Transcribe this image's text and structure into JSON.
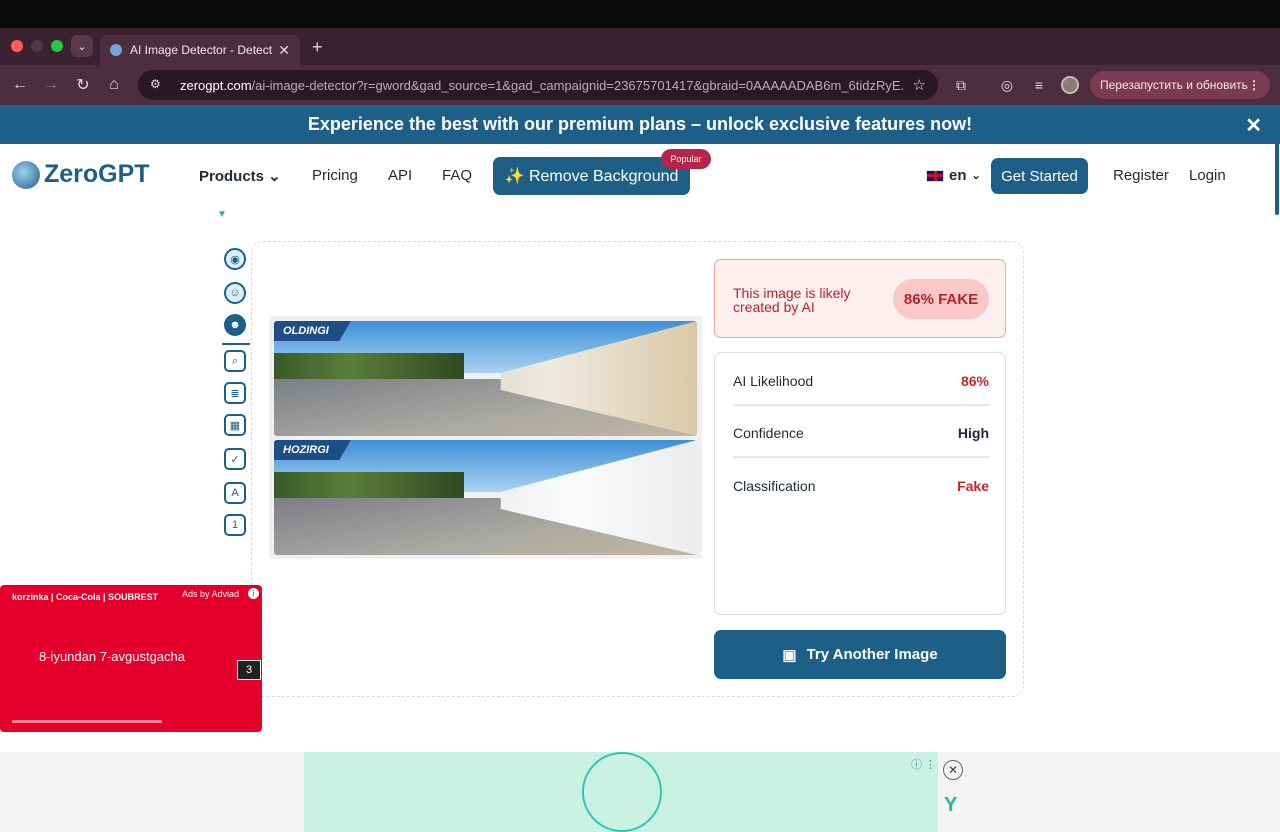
{
  "browser": {
    "tab_title": "AI Image Detector - Detect AI",
    "tab_close": "✕",
    "new_tab": "+",
    "url_domain": "zerogpt.com",
    "url_path": "/ai-image-detector?r=gword&gad_source=1&gad_campaignid=23675701417&gbraid=0AAAAADAB6m_6tidzRyE...",
    "relaunch_label": "Перезапустить и обновить",
    "menu": "⋮"
  },
  "banner": {
    "text": "Experience the best with our premium plans – unlock exclusive features now!",
    "close": "✕"
  },
  "nav": {
    "brand": "ZeroGPT",
    "products": "Products",
    "pricing": "Pricing",
    "api": "API",
    "faq": "FAQ",
    "remove_bg": "✨ Remove Background",
    "popular": "Popular",
    "lang": "en",
    "get_started": "Get Started",
    "register": "Register",
    "login": "Login"
  },
  "images": {
    "top_label": "OLDINGI",
    "bottom_label": "HOZIRGI"
  },
  "result": {
    "message": "This image is likely created by AI",
    "badge": "86% FAKE"
  },
  "stats": [
    {
      "label": "AI Likelihood",
      "value": "86%"
    },
    {
      "label": "Confidence",
      "value": "High"
    },
    {
      "label": "Classification",
      "value": "Fake"
    }
  ],
  "try_button": "Try Another Image",
  "ad": {
    "brands": "korzinka | Coca-Cola | SOUBREST",
    "ads_by": "Ads by Adviad",
    "dates": "8-iyundan 7-avgustgacha",
    "count": "3"
  },
  "colors": {
    "accent": "#1d5f86",
    "fake": "#c62828",
    "ad_red": "#e4002b"
  }
}
